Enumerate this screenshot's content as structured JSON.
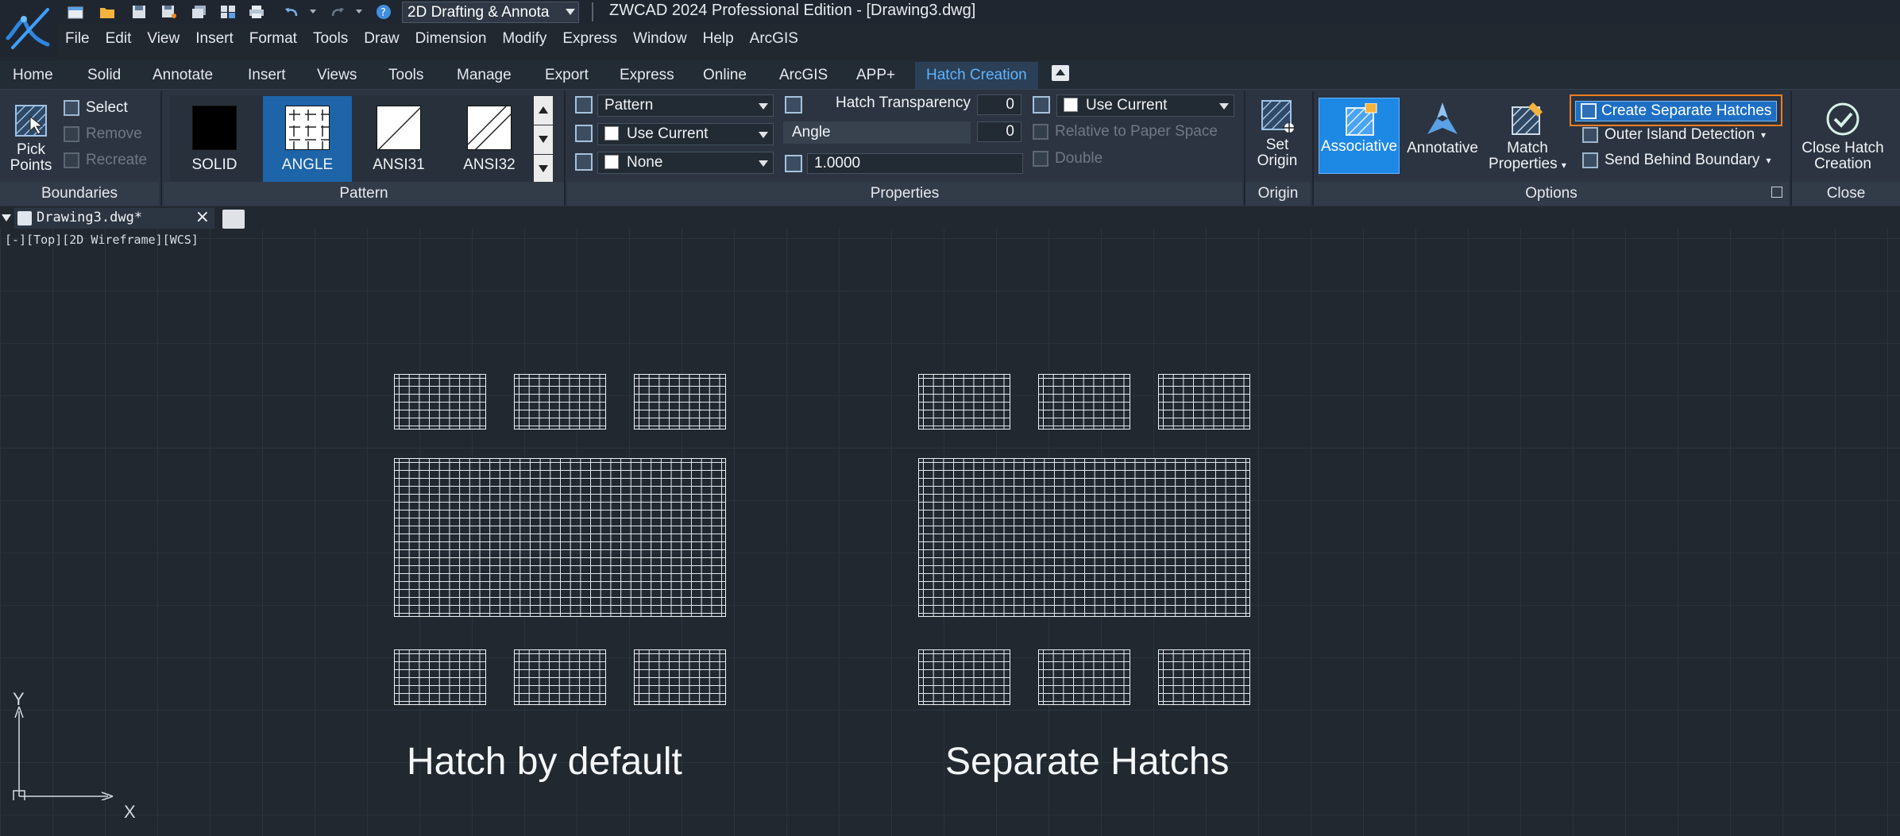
{
  "window": {
    "title": "ZWCAD 2024 Professional Edition - [Drawing3.dwg]",
    "workspace": "2D Drafting & Annota"
  },
  "quick_access": [
    "new-icon",
    "open-icon",
    "save-icon",
    "save-as-icon",
    "multi-save-icon",
    "publish-icon",
    "print-icon",
    "plot-preview-icon",
    "undo-icon",
    "redo-icon",
    "help-icon"
  ],
  "menubar": [
    "File",
    "Edit",
    "View",
    "Insert",
    "Format",
    "Tools",
    "Draw",
    "Dimension",
    "Modify",
    "Express",
    "Window",
    "Help",
    "ArcGIS"
  ],
  "ribbon_tabs": [
    "Home",
    "Solid",
    "Annotate",
    "Insert",
    "Views",
    "Tools",
    "Manage",
    "Export",
    "Express",
    "Online",
    "ArcGIS",
    "APP+",
    "Hatch Creation"
  ],
  "active_ribbon_tab": "Hatch Creation",
  "boundaries": {
    "pick_points": "Pick Points",
    "pick_points_line1": "Pick",
    "pick_points_line2": "Points",
    "select": "Select",
    "remove": "Remove",
    "recreate": "Recreate",
    "title": "Boundaries"
  },
  "pattern": {
    "items": [
      "SOLID",
      "ANGLE",
      "ANSI31",
      "ANSI32"
    ],
    "selected": "ANGLE",
    "title": "Pattern"
  },
  "properties": {
    "hatch_type": "Pattern",
    "hatch_color": "Use Current",
    "background_color": "None",
    "transparency_label": "Hatch Transparency",
    "transparency_value": "0",
    "angle_label": "Angle",
    "angle_value": "0",
    "scale_value": "1.0000",
    "layer": "Use Current",
    "relative_to_paper": "Relative to Paper Space",
    "double": "Double",
    "title": "Properties"
  },
  "origin": {
    "set_origin_line1": "Set",
    "set_origin_line2": "Origin",
    "title": "Origin"
  },
  "options": {
    "associative": "Associative",
    "annotative": "Annotative",
    "match_line1": "Match",
    "match_line2": "Properties",
    "create_separate": "Create Separate Hatches",
    "outer_island": "Outer Island Detection",
    "send_behind": "Send Behind Boundary",
    "title": "Options"
  },
  "close": {
    "line1": "Close Hatch",
    "line2": "Creation",
    "title": "Close"
  },
  "document": {
    "tab_label": "Drawing3.dwg*",
    "viewport_label": "[-][Top][2D Wireframe][WCS]"
  },
  "canvas": {
    "caption_left": "Hatch by default",
    "caption_right": "Separate Hatchs",
    "ucs_x": "X",
    "ucs_y": "Y"
  },
  "colors": {
    "accent": "#1e88e5",
    "highlight_border": "#ef7d22",
    "active_tab_text": "#5fb3ff"
  }
}
